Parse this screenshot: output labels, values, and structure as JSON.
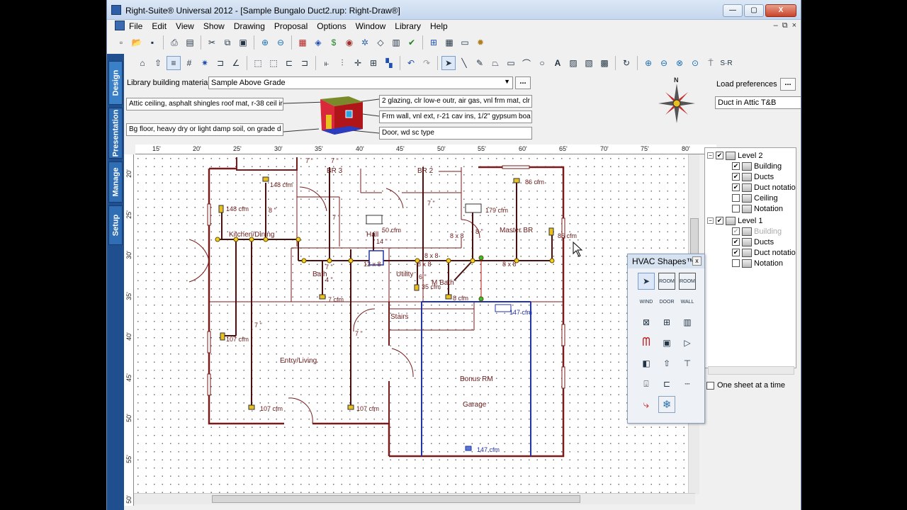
{
  "window": {
    "title": "Right-Suite® Universal 2012 - [Sample Bungalo Duct2.rup: Right-Draw®]",
    "minimize": "—",
    "maximize": "▢",
    "close": "X"
  },
  "menu": [
    "File",
    "Edit",
    "View",
    "Show",
    "Drawing",
    "Proposal",
    "Options",
    "Window",
    "Library",
    "Help"
  ],
  "mdi_controls": [
    "–",
    "⧉",
    "×"
  ],
  "side_tabs": [
    "Design",
    "Presentation",
    "Manage",
    "Setup"
  ],
  "properties": {
    "library_label": "Library building materials",
    "library_value": "Sample Above Grade",
    "ceiling": "Attic ceiling, asphalt shingles roof mat, r-38 ceil ir",
    "floor": "Bg floor, heavy dry or light damp soil, on grade d",
    "glazing": "2 glazing, clr low-e outr, air gas, vnl frm mat, clr",
    "wall": "Frm wall, vnl ext, r-21 cav ins, 1/2\" gypsum boa",
    "door": "Door, wd sc type",
    "compass_north": "N",
    "load_pref_label": "Load preferences",
    "load_pref_value": "Duct in Attic T&B",
    "dots": "..."
  },
  "ruler_h": [
    "15'",
    "20'",
    "25'",
    "30'",
    "35'",
    "40'",
    "45'",
    "50'",
    "55'",
    "60'",
    "65'",
    "70'",
    "75'",
    "80'"
  ],
  "ruler_v": [
    "20'",
    "25'",
    "30'",
    "35'",
    "40'",
    "45'",
    "50'",
    "55'",
    "50'"
  ],
  "plan": {
    "rooms": [
      "BR 3",
      "BR 2",
      "Kitchen/Dining",
      "Hall",
      "Master BR",
      "Bath",
      "Utility",
      "M Bath",
      "Stairs",
      "Entry/Living",
      "Bonus RM",
      "Garage"
    ],
    "cfm": [
      "148 cfm",
      "148 cfm",
      "86 cfm",
      "179 cfm",
      "86 cfm",
      "50 cfm",
      "35 cfm",
      "8 cfm",
      "7 cfm",
      "147 cfm",
      "107 cfm",
      "107 cfm",
      "107 cfm",
      "147 cfm"
    ],
    "duct": [
      "8 x 8",
      "8 x 8",
      "8 x 8",
      "12 x 8",
      "8 x 8",
      "7 \"",
      "8 \"",
      "7 \"",
      "14 \"",
      "7 \"",
      "6 \"",
      "8 \"",
      "7 \"",
      "7 \"",
      "7 \"",
      "7 \"",
      "4 \""
    ]
  },
  "tree": {
    "level2": "Level 2",
    "level2_items": [
      "Building",
      "Ducts",
      "Duct notatio",
      "Ceiling",
      "Notation"
    ],
    "level1": "Level 1",
    "level1_items": [
      "Building",
      "Ducts",
      "Duct notatio",
      "Notation"
    ],
    "one_sheet": "One sheet at a time"
  },
  "hvac_palette": {
    "title": "HVAC Shapes™",
    "close": "x",
    "labels": [
      "ROOM",
      "ROOM",
      "WIND",
      "DOOR",
      "WALL"
    ]
  }
}
